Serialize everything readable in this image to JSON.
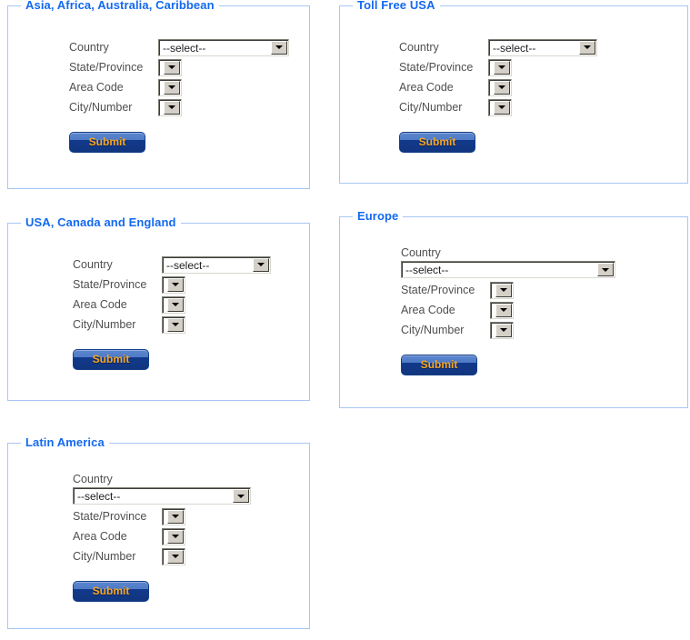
{
  "page": {
    "background_color": "#ffffff",
    "panel_border_color": "#a8c6f5",
    "legend_color": "#1369f0",
    "label_color": "#4f4f4f",
    "submit_text_color": "#f5a623",
    "submit_background_color": "#12398c"
  },
  "field_labels": {
    "country": "Country",
    "state_province": "State/Province",
    "area_code": "Area Code",
    "city_number": "City/Number"
  },
  "values": {
    "select_placeholder": "--select--",
    "empty": ""
  },
  "submit": {
    "label": "Submit"
  },
  "panels": [
    {
      "id": "asia-africa-australia-caribbean",
      "title": "Asia, Africa, Australia, Caribbean",
      "layout": "inline",
      "fields": {
        "country": "--select--",
        "state_province": "",
        "area_code": "",
        "city_number": ""
      },
      "submit_label": "Submit"
    },
    {
      "id": "toll-free-usa",
      "title": "Toll Free USA",
      "layout": "inline",
      "fields": {
        "country": "--select--",
        "state_province": "",
        "area_code": "",
        "city_number": ""
      },
      "submit_label": "Submit"
    },
    {
      "id": "usa-canada-england",
      "title": "USA, Canada and England",
      "layout": "inline",
      "fields": {
        "country": "--select--",
        "state_province": "",
        "area_code": "",
        "city_number": ""
      },
      "submit_label": "Submit"
    },
    {
      "id": "europe",
      "title": "Europe",
      "layout": "stacked",
      "fields": {
        "country": "--select--",
        "state_province": "",
        "area_code": "",
        "city_number": ""
      },
      "submit_label": "Submit"
    },
    {
      "id": "latin-america",
      "title": "Latin America",
      "layout": "stacked",
      "fields": {
        "country": "--select--",
        "state_province": "",
        "area_code": "",
        "city_number": ""
      },
      "submit_label": "Submit"
    }
  ]
}
